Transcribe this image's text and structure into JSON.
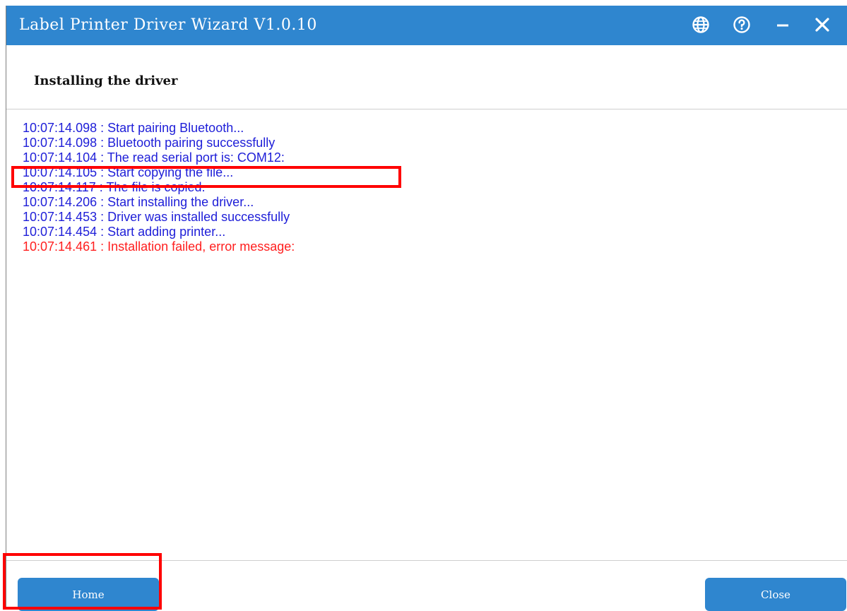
{
  "window": {
    "title": "Label Printer Driver Wizard  V1.0.10",
    "subheading": "Installing the driver"
  },
  "titlebar_icons": [
    "globe-icon",
    "help-icon",
    "minimize-icon",
    "close-icon"
  ],
  "log": [
    {
      "text": "10:07:14.098 : Start pairing Bluetooth...",
      "color": "#1e1ed8"
    },
    {
      "text": "10:07:14.098 : Bluetooth pairing successfully",
      "color": "#1e1ed8"
    },
    {
      "text": "10:07:14.104 : The read serial port is: COM12:",
      "color": "#1e1ed8"
    },
    {
      "text": "10:07:14.105 : Start copying the file...",
      "color": "#1e1ed8"
    },
    {
      "text": "10:07:14.117 : The file is copied.",
      "color": "#1e1ed8"
    },
    {
      "text": "10:07:14.206 : Start installing the driver...",
      "color": "#1e1ed8"
    },
    {
      "text": "10:07:14.453 : Driver was installed successfully",
      "color": "#1e1ed8"
    },
    {
      "text": "10:07:14.454 : Start adding printer...",
      "color": "#1e1ed8"
    },
    {
      "text": "10:07:14.461 : Installation failed, error message:",
      "color": "#ff1e1e"
    }
  ],
  "buttons": {
    "home": "Home",
    "close": "Close"
  },
  "colors": {
    "accent": "#2f86cf",
    "highlight": "#ff0000"
  }
}
